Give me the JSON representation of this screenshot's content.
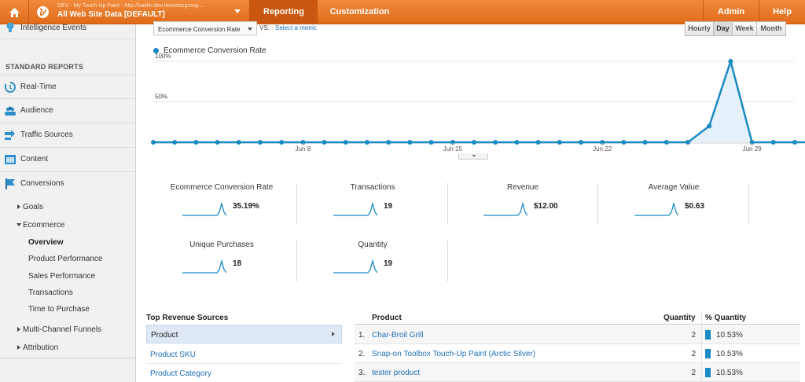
{
  "topbar": {
    "account_line1": "DEV - My Touch Up Paint - http://kaitlin.dev.thevelozgroup....",
    "account_line2": "All Web Site Data [DEFAULT]",
    "nav": {
      "reporting": "Reporting",
      "customization": "Customization",
      "admin": "Admin",
      "help": "Help"
    }
  },
  "sidebar": {
    "intelligence": "Intelligence Events",
    "standard_header": "STANDARD REPORTS",
    "items": {
      "realtime": "Real-Time",
      "audience": "Audience",
      "traffic": "Traffic Sources",
      "content": "Content",
      "conversions": "Conversions"
    },
    "conversions_sub": {
      "goals": "Goals",
      "ecommerce": "Ecommerce",
      "ecommerce_sub": [
        "Overview",
        "Product Performance",
        "Sales Performance",
        "Transactions",
        "Time to Purchase"
      ],
      "mcf": "Multi-Channel Funnels",
      "attribution": "Attribution"
    }
  },
  "controls": {
    "metric": "Ecommerce Conversion Rate",
    "vs": "VS.",
    "select_metric": "Select a metric",
    "time_buttons": [
      "Hourly",
      "Day",
      "Week",
      "Month"
    ],
    "active_time": "Day"
  },
  "chart_data": {
    "type": "area",
    "series": [
      {
        "name": "Ecommerce Conversion Rate",
        "values": [
          0,
          0,
          0,
          0,
          0,
          0,
          0,
          0,
          0,
          0,
          0,
          0,
          0,
          0,
          0,
          0,
          0,
          0,
          0,
          0,
          0,
          0,
          0,
          0,
          0,
          0,
          20,
          100,
          0,
          0,
          0,
          0
        ]
      }
    ],
    "x_ticks": [
      "Jun 8",
      "Jun 15",
      "Jun 22",
      "Jun 29"
    ],
    "y_ticks": [
      "100%",
      "50%"
    ],
    "ylim": [
      0,
      100
    ],
    "grid": true,
    "color": "#1a8ac2"
  },
  "scorecards": [
    {
      "title": "Ecommerce Conversion Rate",
      "value": "35.19%"
    },
    {
      "title": "Transactions",
      "value": "19"
    },
    {
      "title": "Revenue",
      "value": "$12.00"
    },
    {
      "title": "Average Value",
      "value": "$0.63"
    },
    {
      "title": "Unique Purchases",
      "value": "18"
    },
    {
      "title": "Quantity",
      "value": "19"
    }
  ],
  "sources": {
    "header": "Top Revenue Sources",
    "rows": [
      "Product",
      "Product SKU",
      "Product Category"
    ]
  },
  "products": {
    "headers": {
      "product": "Product",
      "quantity": "Quantity",
      "pct": "% Quantity"
    },
    "rows": [
      {
        "num": "1.",
        "name": "Char-Broil Grill",
        "qty": "2",
        "pct": "10.53%",
        "pct_value": 10.53
      },
      {
        "num": "2.",
        "name": "Snap-on Toolbox Touch-Up Paint (Arctic Silver)",
        "qty": "2",
        "pct": "10.53%",
        "pct_value": 10.53
      },
      {
        "num": "3.",
        "name": "tester product",
        "qty": "2",
        "pct": "10.53%",
        "pct_value": 10.53
      }
    ]
  }
}
